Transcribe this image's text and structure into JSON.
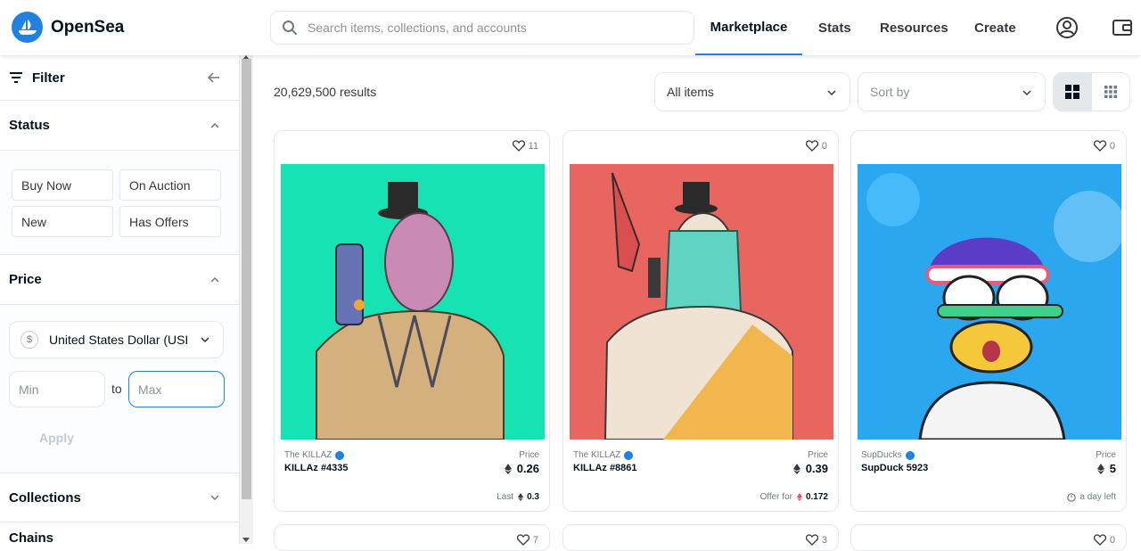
{
  "brand": {
    "name": "OpenSea"
  },
  "search": {
    "placeholder": "Search items, collections, and accounts"
  },
  "nav": {
    "items": [
      "Marketplace",
      "Stats",
      "Resources",
      "Create"
    ]
  },
  "sidebar": {
    "filter_label": "Filter",
    "status": {
      "title": "Status",
      "buttons": [
        "Buy Now",
        "On Auction",
        "New",
        "Has Offers"
      ]
    },
    "price": {
      "title": "Price",
      "currency_symbol": "$",
      "currency": "United States Dollar (USD)",
      "min_placeholder": "Min",
      "max_placeholder": "Max",
      "to_label": "to",
      "apply_label": "Apply"
    },
    "collections_title": "Collections",
    "next_section_title": "Chains"
  },
  "main": {
    "results": "20,629,500 results",
    "items_filter": "All items",
    "sort_placeholder": "Sort by"
  },
  "cards": [
    {
      "likes": "11",
      "collection": "The KILLAZ",
      "name": "KILLAz #4335",
      "price_label": "Price",
      "price": "0.26",
      "foot_label": "Last",
      "foot_value": "0.3",
      "bg": "#17e2b4"
    },
    {
      "likes": "0",
      "collection": "The KILLAZ",
      "name": "KILLAz #8861",
      "price_label": "Price",
      "price": "0.39",
      "foot_label": "Offer for",
      "foot_value": "0.172",
      "bg": "#e8665f"
    },
    {
      "likes": "0",
      "collection": "SupDucks",
      "name": "SupDuck 5923",
      "price_label": "Price",
      "price": "5",
      "foot_label": "a day left",
      "foot_value": "",
      "bg": "#2aa7ef"
    }
  ],
  "next_row_likes": [
    "7",
    "3",
    "0"
  ],
  "colors": {
    "accent": "#2081e2",
    "text": "#04111d",
    "muted": "#707a83",
    "border": "#e5e8eb"
  }
}
